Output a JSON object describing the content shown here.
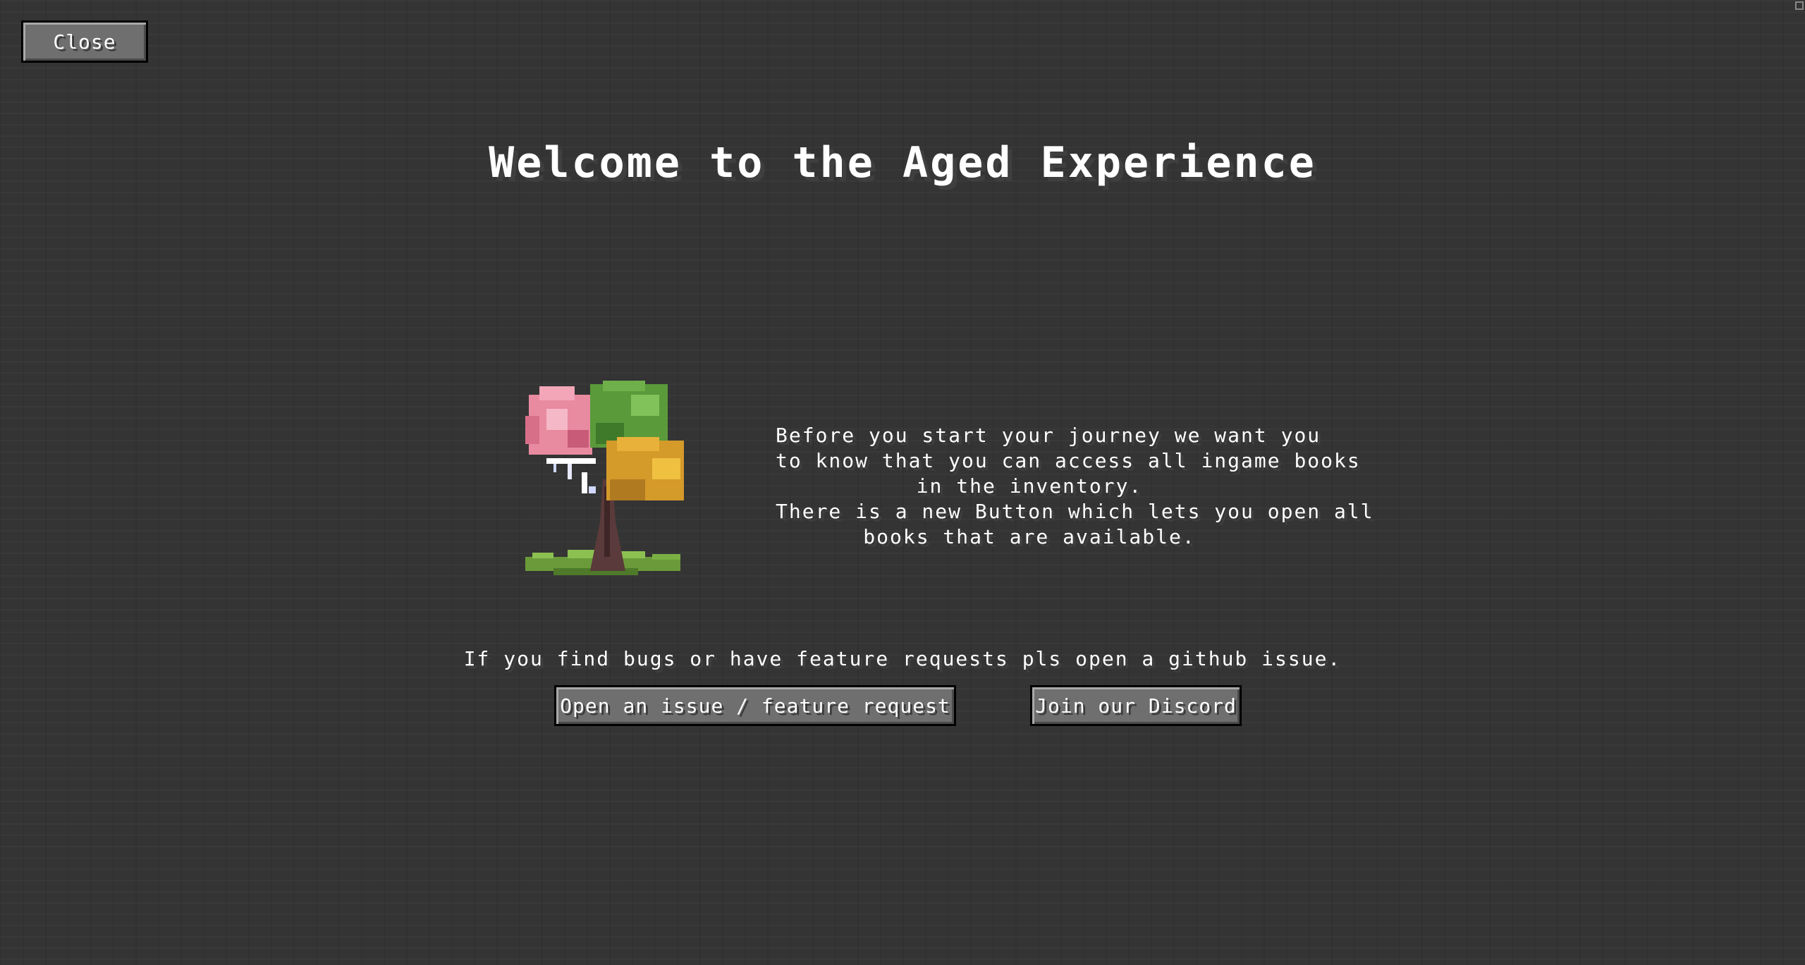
{
  "header": {
    "close_label": "Close"
  },
  "welcome": {
    "title": "Welcome to the Aged Experience",
    "description_lines": [
      "Before you start your journey we want you",
      "to know that you can access all ingame books",
      "in the inventory.",
      "There is a new Button which lets you open all",
      "books that are available."
    ],
    "bug_note": "If you find bugs or have feature requests pls open a github issue."
  },
  "actions": {
    "issue_label": "Open an issue / feature request",
    "discord_label": "Join our Discord"
  },
  "icons": {
    "logo": "four-seasons-tree-icon",
    "corner": "window-corner-icon"
  },
  "colors": {
    "background": "#343434",
    "button_face": "#6f6f6f",
    "text": "#ffffff"
  }
}
